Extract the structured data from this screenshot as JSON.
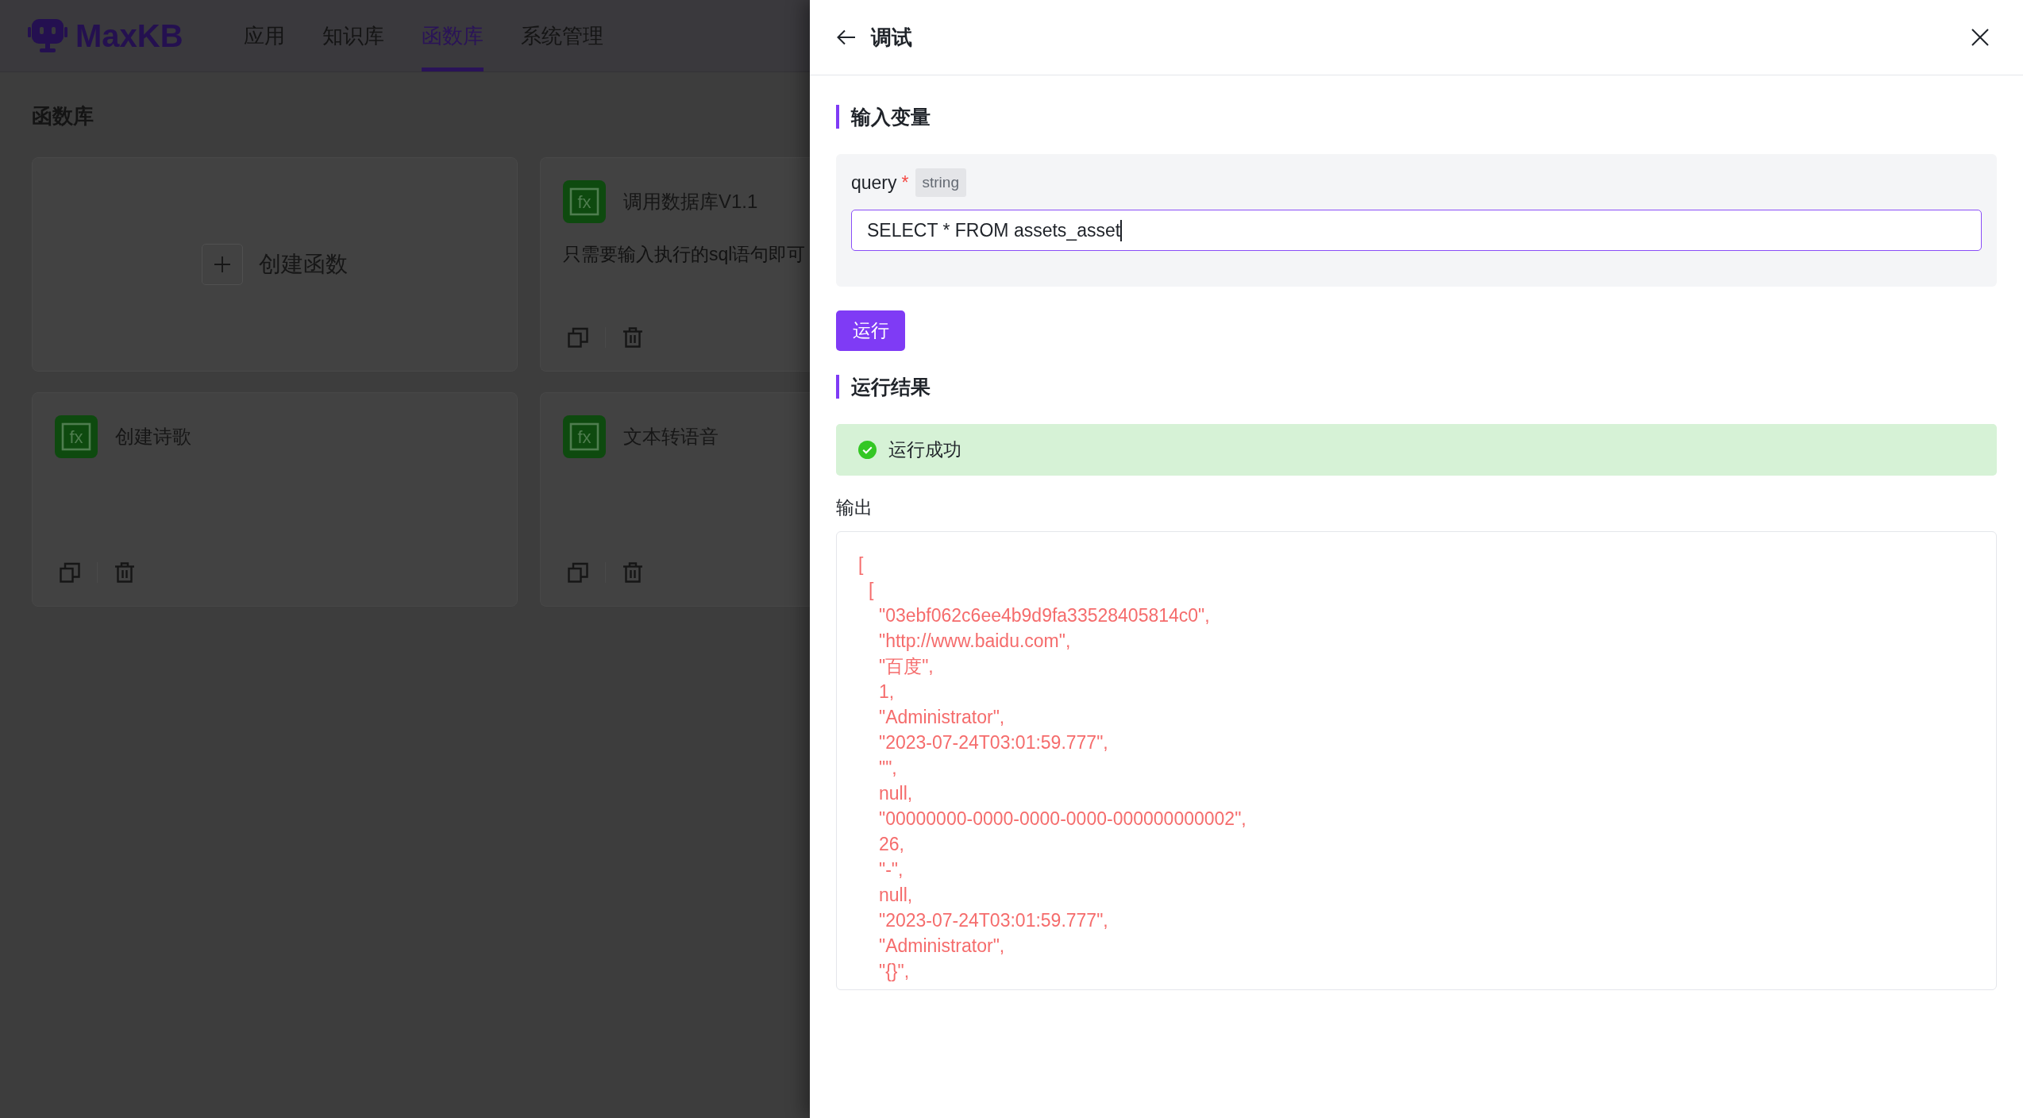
{
  "app": {
    "logo_text": "MaxKB"
  },
  "nav": [
    {
      "label": "应用",
      "selected": false
    },
    {
      "label": "知识库",
      "selected": false
    },
    {
      "label": "函数库",
      "selected": true
    },
    {
      "label": "系统管理",
      "selected": false
    }
  ],
  "page": {
    "title": "函数库",
    "create_card": {
      "label": "创建函数"
    },
    "functions": [
      {
        "icon_text": "fx",
        "title": "调用数据库V1.1",
        "description": "只需要输入执行的sql语句即可"
      },
      {
        "icon_text": "fx",
        "title": "创建诗歌"
      },
      {
        "icon_text": "fx",
        "title": "文本转语音"
      }
    ]
  },
  "drawer": {
    "title": "调试",
    "input_section": {
      "title": "输入变量",
      "fields": [
        {
          "label": "query",
          "required_mark": "*",
          "type": "string",
          "value": "SELECT * FROM assets_asset",
          "focused": true
        }
      ]
    },
    "run_button": "运行",
    "result_section": {
      "title": "运行结果",
      "status": {
        "kind": "success",
        "message": "运行成功"
      },
      "output_label": "输出",
      "output": [
        {
          "text": "[",
          "children": [
            {
              "text": "[",
              "children": [
                {
                  "text": "\"03ebf062c6ee4b9d9fa33528405814c0\","
                },
                {
                  "text": "\"http://www.baidu.com\","
                },
                {
                  "text": "\"百度\","
                },
                {
                  "text": "1,"
                },
                {
                  "text": "\"Administrator\","
                },
                {
                  "text": "\"2023-07-24T03:01:59.777\","
                },
                {
                  "text": "\"\","
                },
                {
                  "text": "null,"
                },
                {
                  "text": "\"00000000-0000-0000-0000-000000000002\","
                },
                {
                  "text": "26,"
                },
                {
                  "text": "\"-\","
                },
                {
                  "text": "null,"
                },
                {
                  "text": "\"2023-07-24T03:01:59.777\","
                },
                {
                  "text": "\"Administrator\","
                },
                {
                  "text": "\"{}\","
                }
              ]
            }
          ]
        }
      ]
    }
  }
}
